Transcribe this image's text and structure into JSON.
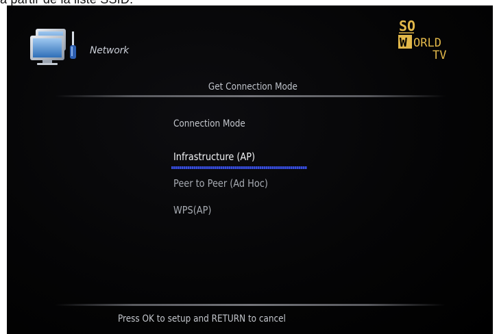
{
  "caption": "a partir de la liste SSID.",
  "header": {
    "section_label": "Network",
    "section_icon": "network-computers-icon",
    "logo": {
      "line1": "SO",
      "line2_letter": "W",
      "line2_rest": "ORLD",
      "line3": "TV",
      "accent_color": "#e2b84a"
    }
  },
  "dialog": {
    "title": "Get Connection Mode",
    "field_label": "Connection Mode",
    "options": [
      {
        "label": "Infrastructure (AP)",
        "selected": true
      },
      {
        "label": "Peer to Peer (Ad Hoc)",
        "selected": false
      },
      {
        "label": "WPS(AP)",
        "selected": false
      }
    ],
    "selection_color": "#3a4fd8"
  },
  "footer": {
    "hint": "Press OK to setup and RETURN to cancel"
  }
}
